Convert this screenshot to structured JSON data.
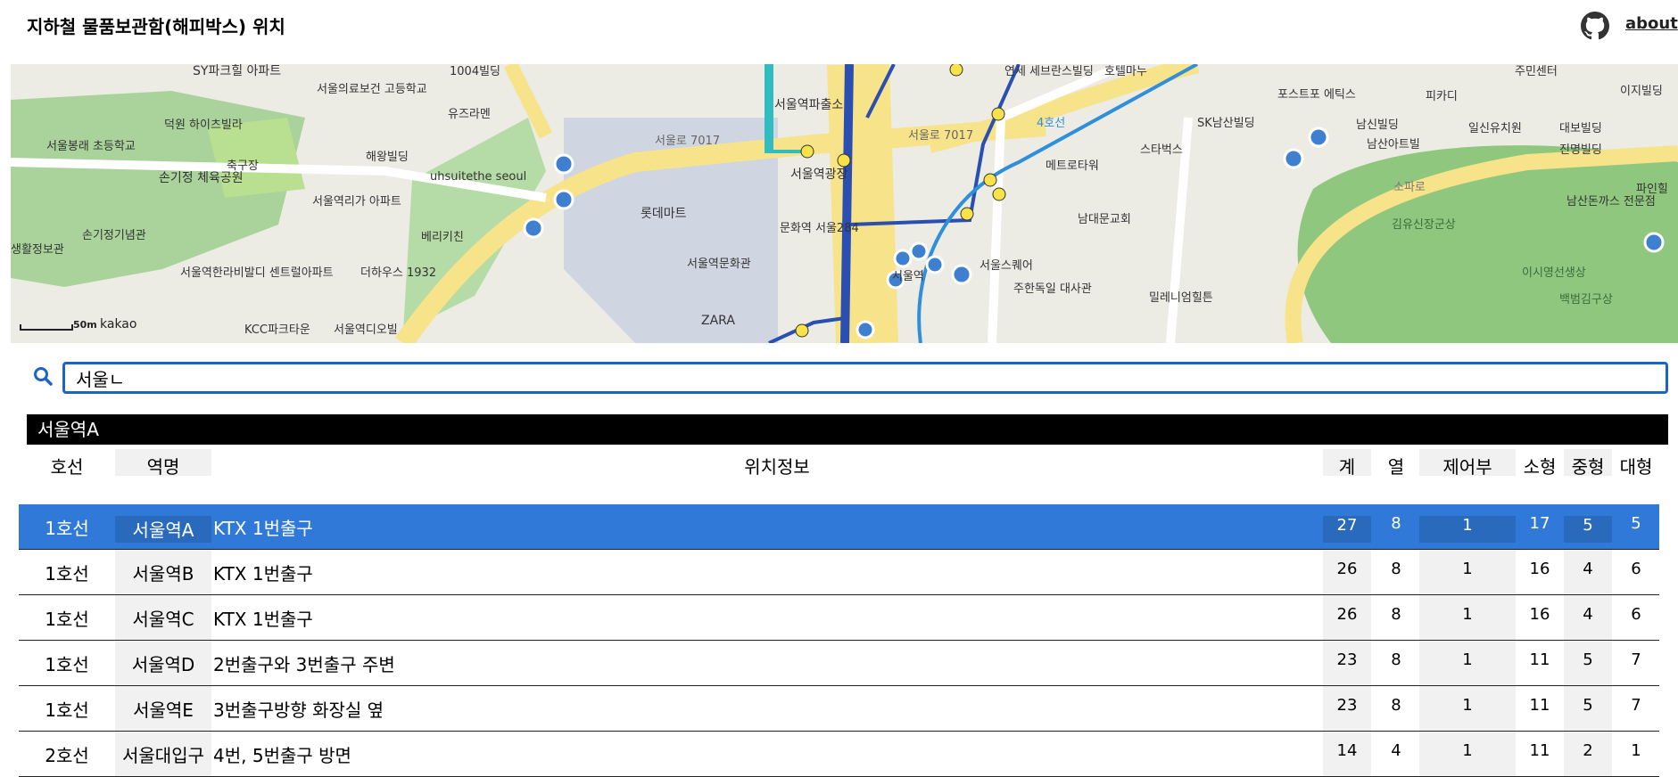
{
  "header": {
    "title": "지하철 물품보관함(해피박스) 위치",
    "github_icon": "github-icon",
    "about_label": "about"
  },
  "map": {
    "scale_label": "50m",
    "provider": "kakao",
    "labels": [
      "SY파크힐 아파트",
      "1004빌딩",
      "서울의료보건 고등학교",
      "유즈라멘",
      "덕원 하이츠빌라",
      "서울봉래 초등학교",
      "축구장",
      "손기정 체육공원",
      "해왕빌딩",
      "uhsuitethe seoul",
      "서울역리가 아파트",
      "손기정기념관",
      "베리키친",
      "생활정보관",
      "서울역한라비발디 센트럴아파트",
      "더하우스 1932",
      "KCC파크타운",
      "서울역디오빌",
      "서울로 7017",
      "롯데마트",
      "서울역문화관",
      "ZARA",
      "서울역파출소",
      "서울역광장",
      "문화역 서울284",
      "서울로 7017",
      "연세 세브란스빌딩",
      "호텔마누",
      "메트로타워",
      "스타벅스",
      "SK남산빌딩",
      "포스트포 에틱스",
      "피카디",
      "남신빌딩",
      "남산아트빌",
      "주민센터",
      "이지빌딩",
      "일신유치원",
      "대보빌딩",
      "진명빌딩",
      "남대문교회",
      "서울스퀘어",
      "주한독일 대사관",
      "밀레니엄힐튼",
      "김유신장군상",
      "남산돈까스 전문점",
      "이시영선생상",
      "백범김구상",
      "파인힐",
      "소파로",
      "4호선",
      "서울역"
    ]
  },
  "search": {
    "value": "서울ㄴ",
    "icon": "search-icon"
  },
  "selected_station": "서울역A",
  "table": {
    "headers": {
      "line": "호선",
      "name": "역명",
      "location": "위치정보",
      "total": "계",
      "columns": "열",
      "control": "제어부",
      "small": "소형",
      "medium": "중형",
      "large": "대형"
    },
    "rows": [
      {
        "line": "1호선",
        "name": "서울역A",
        "location": "KTX 1번출구",
        "total": "27",
        "columns": "8",
        "control": "1",
        "small": "17",
        "medium": "5",
        "large": "5"
      },
      {
        "line": "1호선",
        "name": "서울역B",
        "location": "KTX 1번출구",
        "total": "26",
        "columns": "8",
        "control": "1",
        "small": "16",
        "medium": "4",
        "large": "6"
      },
      {
        "line": "1호선",
        "name": "서울역C",
        "location": "KTX 1번출구",
        "total": "26",
        "columns": "8",
        "control": "1",
        "small": "16",
        "medium": "4",
        "large": "6"
      },
      {
        "line": "1호선",
        "name": "서울역D",
        "location": "2번출구와 3번출구 주변",
        "total": "23",
        "columns": "8",
        "control": "1",
        "small": "11",
        "medium": "5",
        "large": "7"
      },
      {
        "line": "1호선",
        "name": "서울역E",
        "location": "3번출구방향 화장실 옆",
        "total": "23",
        "columns": "8",
        "control": "1",
        "small": "11",
        "medium": "5",
        "large": "7"
      },
      {
        "line": "2호선",
        "name": "서울대입구",
        "location": "4번, 5번출구 방면",
        "total": "14",
        "columns": "4",
        "control": "1",
        "small": "11",
        "medium": "2",
        "large": "1"
      }
    ]
  }
}
